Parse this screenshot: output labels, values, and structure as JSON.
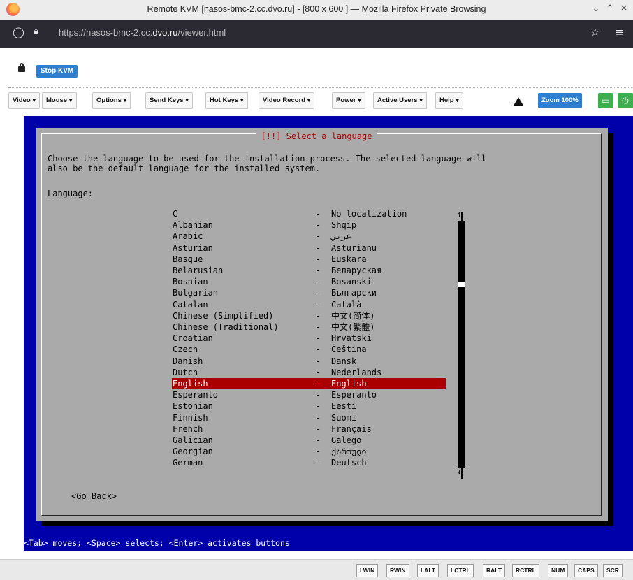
{
  "window": {
    "title": "Remote KVM [nasos-bmc-2.cc.dvo.ru] - [800 x 600 ] — Mozilla Firefox Private Browsing",
    "url_prefix": "https://nasos-bmc-2.cc.",
    "url_domain": "dvo.ru",
    "url_path": "/viewer.html"
  },
  "kvm": {
    "stop_label": "Stop KVM",
    "menus": [
      "Video ▾",
      "Mouse ▾",
      "Options ▾",
      "Send Keys ▾",
      "Hot Keys ▾",
      "Video Record ▾",
      "Power ▾",
      "Active Users ▾",
      "Help ▾"
    ],
    "zoom_label": "Zoom 100%"
  },
  "installer": {
    "title": "[!!] Select a language",
    "description_line1": "Choose the language to be used for the installation process. The selected language will",
    "description_line2": "also be the default language for the installed system.",
    "language_label": "Language:",
    "languages": [
      {
        "name": "C",
        "native": "No localization"
      },
      {
        "name": "Albanian",
        "native": "Shqip"
      },
      {
        "name": "Arabic",
        "native": "عربي"
      },
      {
        "name": "Asturian",
        "native": "Asturianu"
      },
      {
        "name": "Basque",
        "native": "Euskara"
      },
      {
        "name": "Belarusian",
        "native": "Беларуская"
      },
      {
        "name": "Bosnian",
        "native": "Bosanski"
      },
      {
        "name": "Bulgarian",
        "native": "Български"
      },
      {
        "name": "Catalan",
        "native": "Català"
      },
      {
        "name": "Chinese (Simplified)",
        "native": "中文(简体)"
      },
      {
        "name": "Chinese (Traditional)",
        "native": "中文(繁體)"
      },
      {
        "name": "Croatian",
        "native": "Hrvatski"
      },
      {
        "name": "Czech",
        "native": "Čeština"
      },
      {
        "name": "Danish",
        "native": "Dansk"
      },
      {
        "name": "Dutch",
        "native": "Nederlands"
      },
      {
        "name": "English",
        "native": "English"
      },
      {
        "name": "Esperanto",
        "native": "Esperanto"
      },
      {
        "name": "Estonian",
        "native": "Eesti"
      },
      {
        "name": "Finnish",
        "native": "Suomi"
      },
      {
        "name": "French",
        "native": "Français"
      },
      {
        "name": "Galician",
        "native": "Galego"
      },
      {
        "name": "Georgian",
        "native": "ქართული"
      },
      {
        "name": "German",
        "native": "Deutsch"
      }
    ],
    "selected_language": "English",
    "dash": "-",
    "go_back": "<Go Back>",
    "help_line": "<Tab> moves; <Space> selects; <Enter> activates buttons"
  },
  "keys": [
    "LWIN",
    "RWIN",
    "LALT",
    "LCTRL",
    "RALT",
    "RCTRL",
    "NUM",
    "CAPS",
    "SCR"
  ]
}
